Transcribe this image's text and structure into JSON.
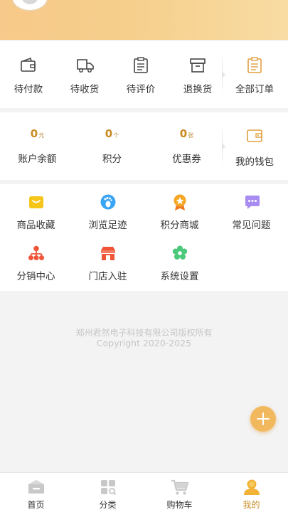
{
  "orders": {
    "items": [
      {
        "label": "待付款",
        "icon": "wallet-icon"
      },
      {
        "label": "待收货",
        "icon": "truck-icon"
      },
      {
        "label": "待评价",
        "icon": "clipboard-icon"
      },
      {
        "label": "退换货",
        "icon": "return-box-icon"
      }
    ],
    "all_orders_label": "全部订单"
  },
  "wallet": {
    "items": [
      {
        "value": "0",
        "unit": "元",
        "label": "账户余额"
      },
      {
        "value": "0",
        "unit": "个",
        "label": "积分"
      },
      {
        "value": "0",
        "unit": "张",
        "label": "优惠券"
      }
    ],
    "my_wallet_label": "我的钱包"
  },
  "services": {
    "items": [
      {
        "label": "商品收藏",
        "icon": "favorites-icon",
        "color": "#f5c518"
      },
      {
        "label": "浏览足迹",
        "icon": "footprint-icon",
        "color": "#3ba5f5"
      },
      {
        "label": "积分商城",
        "icon": "medal-icon",
        "color": "#f59a23"
      },
      {
        "label": "常见问题",
        "icon": "chat-icon",
        "color": "#a98cf2"
      },
      {
        "label": "分销中心",
        "icon": "org-chart-icon",
        "color": "#f0553a"
      },
      {
        "label": "门店入驻",
        "icon": "store-icon",
        "color": "#f0553a"
      },
      {
        "label": "系统设置",
        "icon": "flower-settings-icon",
        "color": "#4cc87a"
      }
    ]
  },
  "footer": {
    "company": "郑州君然电子科技有限公司版权所有",
    "copyright": "Copyright 2020-2025"
  },
  "tabbar": {
    "items": [
      {
        "label": "首页",
        "icon": "home-icon"
      },
      {
        "label": "分类",
        "icon": "category-icon"
      },
      {
        "label": "购物车",
        "icon": "cart-icon"
      },
      {
        "label": "我的",
        "icon": "profile-icon",
        "active": true
      }
    ]
  },
  "colors": {
    "header_gradient_start": "#f7c98a",
    "accent_gold": "#c9902a",
    "icon_gray": "#555555"
  }
}
